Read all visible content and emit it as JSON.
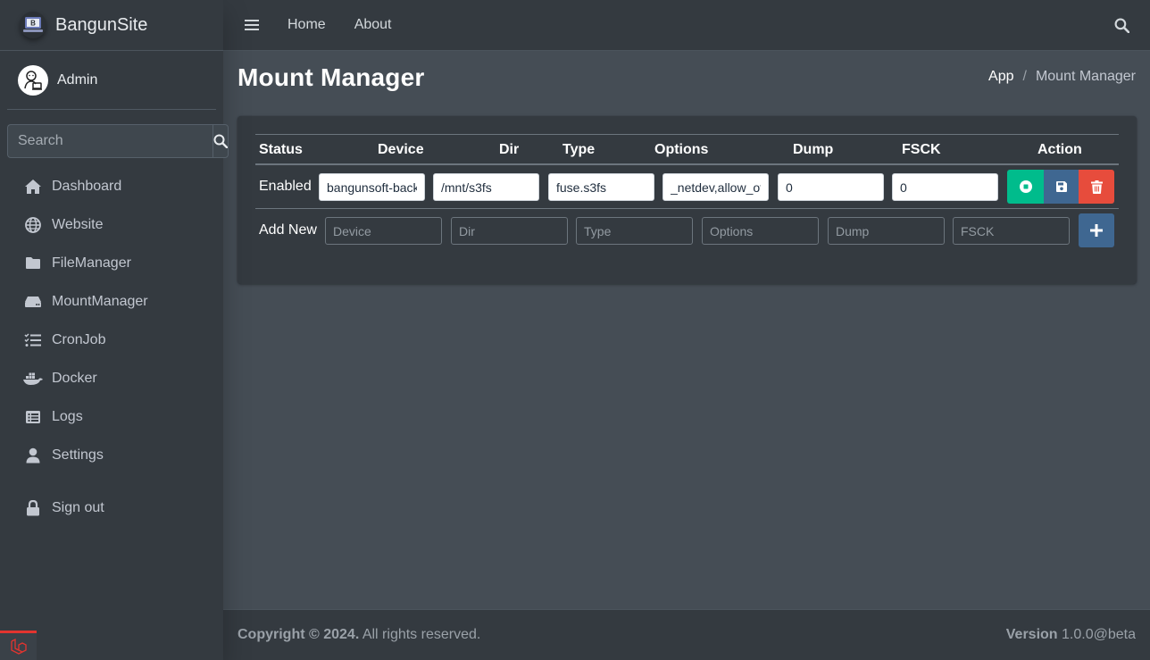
{
  "brand": {
    "name": "BangunSite",
    "logo_letter": "B"
  },
  "user": {
    "name": "Admin"
  },
  "sidebar": {
    "search_placeholder": "Search",
    "items": [
      {
        "label": "Dashboard",
        "icon": "home-icon"
      },
      {
        "label": "Website",
        "icon": "globe-icon"
      },
      {
        "label": "FileManager",
        "icon": "folder-icon"
      },
      {
        "label": "MountManager",
        "icon": "hdd-icon"
      },
      {
        "label": "CronJob",
        "icon": "tasks-icon"
      },
      {
        "label": "Docker",
        "icon": "docker-icon"
      },
      {
        "label": "Logs",
        "icon": "list-alt-icon"
      },
      {
        "label": "Settings",
        "icon": "user-icon"
      }
    ],
    "signout": {
      "label": "Sign out",
      "icon": "lock-icon"
    }
  },
  "topnav": {
    "links": [
      "Home",
      "About"
    ]
  },
  "page": {
    "title": "Mount Manager",
    "breadcrumb": [
      "App",
      "Mount Manager"
    ]
  },
  "table": {
    "headers": [
      "Status",
      "Device",
      "Dir",
      "Type",
      "Options",
      "Dump",
      "FSCK",
      "Action"
    ],
    "rows": [
      {
        "status": "Enabled",
        "device": "bangunsoft-backup",
        "dir": "/mnt/s3fs",
        "type": "fuse.s3fs",
        "options": "_netdev,allow_other",
        "dump": "0",
        "fsck": "0"
      }
    ],
    "add_row": {
      "label": "Add New",
      "placeholders": {
        "device": "Device",
        "dir": "Dir",
        "type": "Type",
        "options": "Options",
        "dump": "Dump",
        "fsck": "FSCK"
      }
    }
  },
  "footer": {
    "copyright_bold": "Copyright © 2024.",
    "copyright_rest": " All rights reserved.",
    "version_label": "Version",
    "version_value": " 1.0.0@beta"
  },
  "colors": {
    "success": "#00bc8c",
    "primary": "#3f6791",
    "danger": "#e74c3c",
    "sidebar": "#343a40",
    "content": "#454d55"
  }
}
